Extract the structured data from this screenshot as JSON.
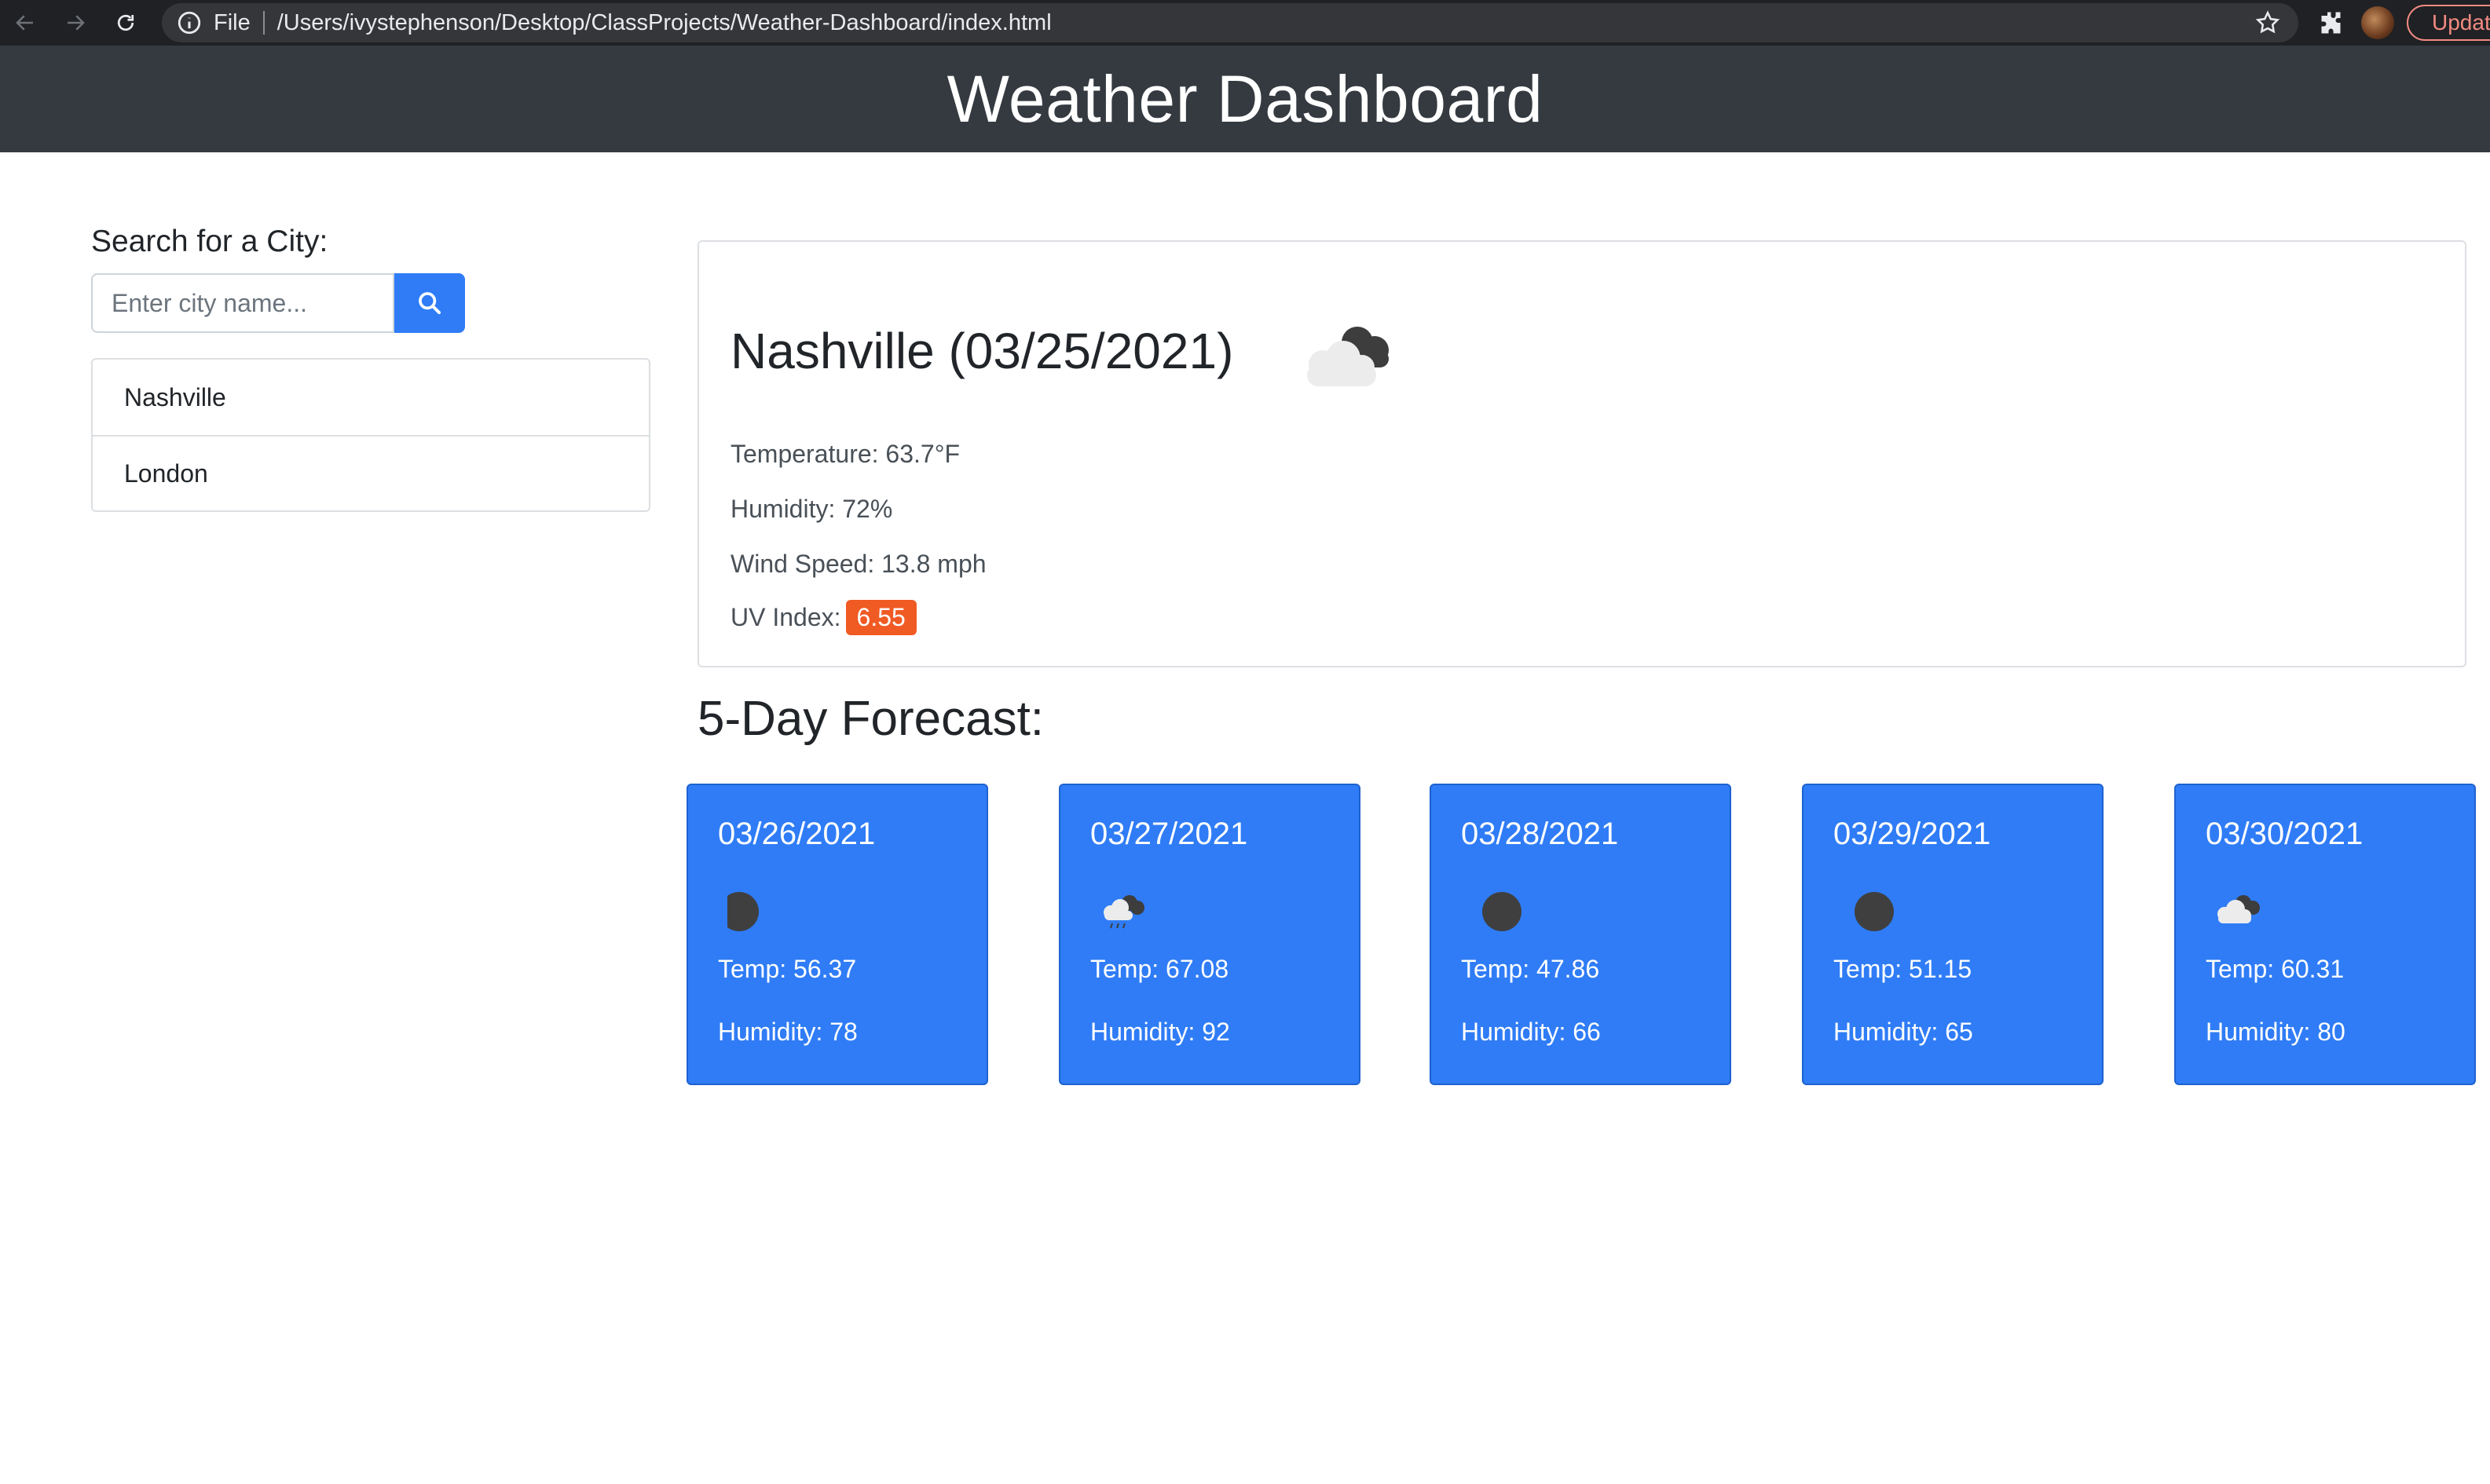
{
  "browser": {
    "scheme_label": "File",
    "url": "/Users/ivystephenson/Desktop/ClassProjects/Weather-Dashboard/index.html",
    "update_label": "Updat"
  },
  "header": {
    "title": "Weather Dashboard"
  },
  "search": {
    "label": "Search for a City:",
    "placeholder": "Enter city name...",
    "history": [
      "Nashville",
      "London"
    ]
  },
  "current": {
    "title": "Nashville (03/25/2021)",
    "icon": "broken-clouds-icon",
    "temperature": "Temperature: 63.7°F",
    "humidity": "Humidity: 72%",
    "wind": "Wind Speed: 13.8 mph",
    "uv_label": "UV Index:",
    "uv_value": "6.55",
    "uv_color": "#f05a23"
  },
  "forecast": {
    "title": "5-Day Forecast:",
    "days": [
      {
        "date": "03/26/2021",
        "icon": "dark-circle-icon",
        "temp": "Temp: 56.37",
        "humidity": "Humidity: 78"
      },
      {
        "date": "03/27/2021",
        "icon": "rain-cloud-icon",
        "temp": "Temp: 67.08",
        "humidity": "Humidity: 92"
      },
      {
        "date": "03/28/2021",
        "icon": "dark-circle-icon",
        "temp": "Temp: 47.86",
        "humidity": "Humidity: 66"
      },
      {
        "date": "03/29/2021",
        "icon": "dark-circle-icon",
        "temp": "Temp: 51.15",
        "humidity": "Humidity: 65"
      },
      {
        "date": "03/30/2021",
        "icon": "broken-clouds-icon",
        "temp": "Temp: 60.31",
        "humidity": "Humidity: 80"
      }
    ]
  },
  "colors": {
    "header_bg": "#343a40",
    "accent": "#2f7cf6",
    "uv_badge": "#f05a23"
  }
}
